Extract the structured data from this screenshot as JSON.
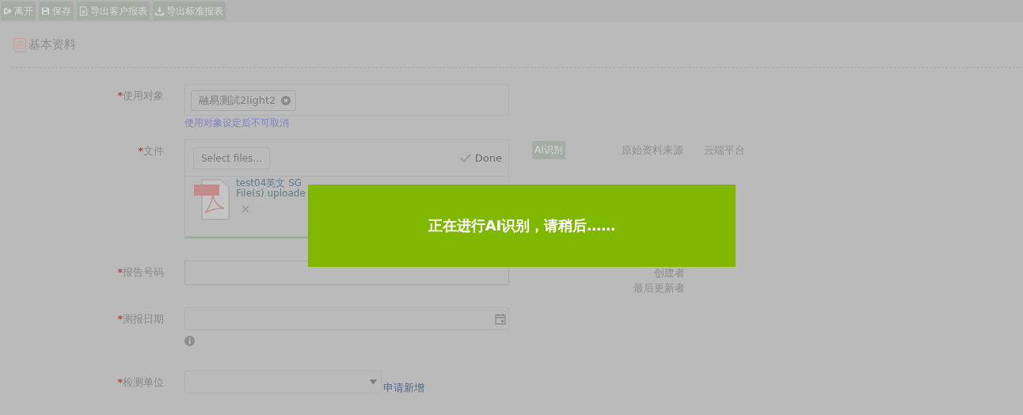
{
  "toolbar": [
    {
      "label": "离开",
      "kind": "exit"
    },
    {
      "label": "保存",
      "kind": "save"
    },
    {
      "label": "导出客户报表",
      "kind": "excel"
    },
    {
      "label": "导出标准报表",
      "kind": "download"
    }
  ],
  "section": {
    "title": "基本资料"
  },
  "form": {
    "target": {
      "mark": "*",
      "label": "使用对象",
      "tags": [
        "融易测試2light2"
      ],
      "hint": "使用对象设定后不可取消"
    },
    "file": {
      "mark": "*",
      "label": "文件",
      "select_button": "Select files...",
      "done": "Done",
      "files": [
        {
          "name": "test04英文  SG",
          "status": "File(s) uploade",
          "level": 1
        }
      ]
    },
    "report_no": {
      "mark": "*",
      "label": "报告号码"
    },
    "date": {
      "mark": "*",
      "label": "测报日期"
    },
    "lab": {
      "mark": "*",
      "label": "检测单位",
      "link": "申请新增"
    }
  },
  "side": {
    "ai_button": "AI识别",
    "source_label": "原始资料来源",
    "source_value": "云端平台",
    "creator_label": "创建者",
    "updater_label": "最后更新者"
  },
  "loading": {
    "message": "正在进行AI识别，请稍后……"
  }
}
